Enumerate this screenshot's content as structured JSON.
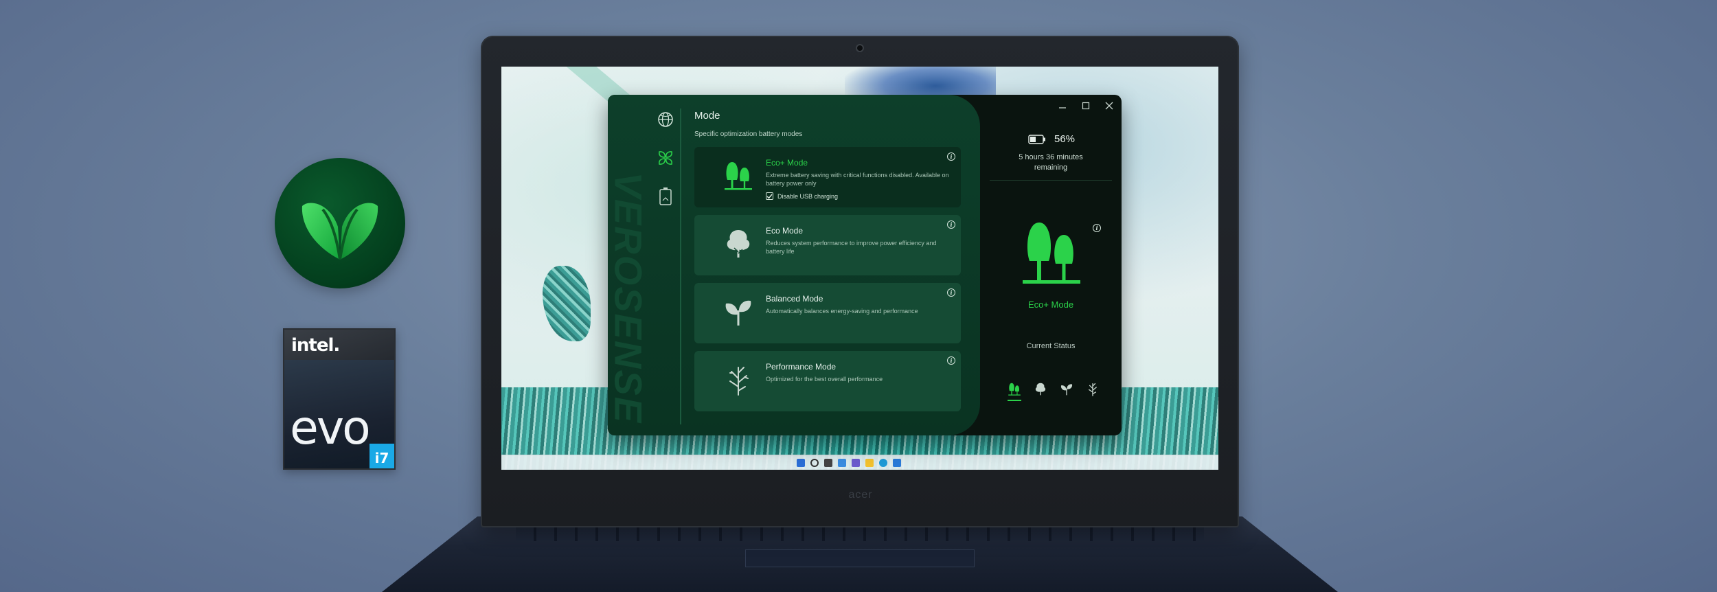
{
  "badges": {
    "intel_label": "intel.",
    "evo_label": "evo",
    "chip_label": "i7"
  },
  "laptop": {
    "brand": "acer"
  },
  "app": {
    "brand_vertical": "VEROSENSE",
    "title": "Mode",
    "subtitle": "Specific optimization battery modes",
    "modes": [
      {
        "name": "Eco+ Mode",
        "description": "Extreme battery saving with critical functions disabled. Available on battery power only",
        "checkbox_label": "Disable USB charging",
        "checkbox_checked": true,
        "selected": true,
        "icon": "twin-trees-icon"
      },
      {
        "name": "Eco Mode",
        "description": "Reduces system performance to improve power efficiency and battery life",
        "selected": false,
        "icon": "tree-icon"
      },
      {
        "name": "Balanced Mode",
        "description": "Automatically balances energy-saving and performance",
        "selected": false,
        "icon": "sprout-icon"
      },
      {
        "name": "Performance Mode",
        "description": "Optimized for the best overall performance",
        "selected": false,
        "icon": "bare-tree-icon"
      }
    ],
    "status": {
      "battery_percent": "56%",
      "remaining_line1": "5 hours 36 minutes",
      "remaining_line2": "remaining",
      "current_mode": "Eco+ Mode",
      "current_status": "Current Status"
    }
  },
  "colors": {
    "accent_green": "#2bd24a",
    "panel_green": "#0d3f2a",
    "card_green": "#154b34",
    "intel_blue": "#1aa9e6"
  }
}
